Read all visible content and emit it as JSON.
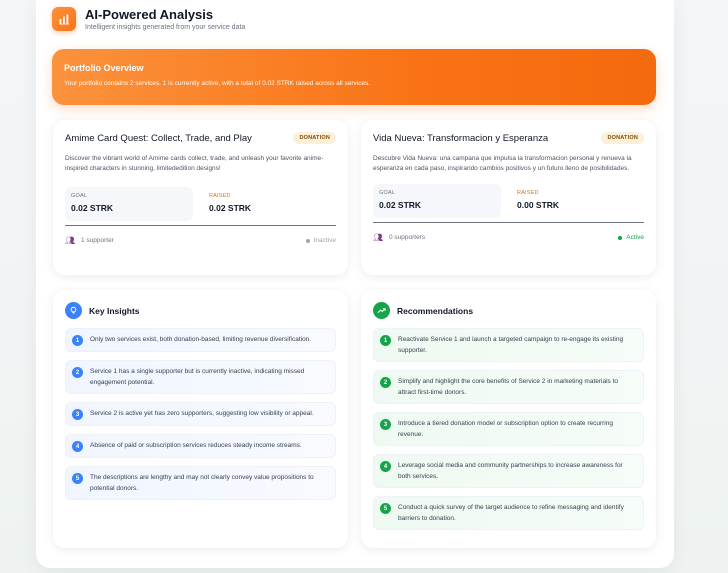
{
  "header": {
    "title": "AI-Powered Analysis",
    "subtitle": "Intelligent insights generated from your service data",
    "icon": "bar-chart-icon"
  },
  "overview": {
    "title": "Portfolio Overview",
    "text": "Your portfolio contains 2 services. 1 is currently active, with a total of 0.02 STRK raised across all services."
  },
  "services": [
    {
      "title": "Amime Card Quest: Collect, Trade, and Play",
      "badge": "DONATION",
      "description": "Discover the vibrant world of Amime cards collect, trade, and unleash your favorite anime-inspired characters in stunning, limitededition designs!",
      "goal_label": "GOAL",
      "goal": "0.02 STRK",
      "raised_label": "RAISED",
      "raised": "0.02 STRK",
      "supporters": "1 supporter",
      "status": "Inactive"
    },
    {
      "title": "Vida Nueva: Transformacion y Esperanza",
      "badge": "DONATION",
      "description": "Descubre Vida Nueva: una campana que impulsa la transformacion personal y renueva la esperanza en cada paso, inspirando cambios positivos y un futuro lleno de posibilidades.",
      "goal_label": "GOAL",
      "goal": "0.02 STRK",
      "raised_label": "RAISED",
      "raised": "0.00 STRK",
      "supporters": "0 supporters",
      "status": "Active"
    }
  ],
  "insights": {
    "title": "Key Insights",
    "items": [
      "Only two services exist, both donation-based, limiting revenue diversification.",
      "Service 1 has a single supporter but is currently inactive, indicating missed engagement potential.",
      "Service 2 is active yet has zero supporters, suggesting low visibility or appeal.",
      "Absence of paid or subscription services reduces steady income streams.",
      "The descriptions are lengthy and may not clearly convey value propositions to potential donors."
    ]
  },
  "recommendations": {
    "title": "Recommendations",
    "items": [
      "Reactivate Service 1 and launch a targeted campaign to re-engage its existing supporter.",
      "Simplify and highlight the core benefits of Service 2 in marketing materials to attract first-time donors.",
      "Introduce a tiered donation model or subscription option to create recurring revenue.",
      "Leverage social media and community partnerships to increase awareness for both services.",
      "Conduct a quick survey of the target audience to refine messaging and identify barriers to donation."
    ]
  },
  "numbers": [
    "1",
    "2",
    "3",
    "4",
    "5"
  ],
  "colors": {
    "accent_orange": "#f97316",
    "insight_blue": "#3b82f6",
    "recommend_green": "#16a34a",
    "status_active": "#16a34a",
    "status_inactive": "#9ca3af"
  }
}
